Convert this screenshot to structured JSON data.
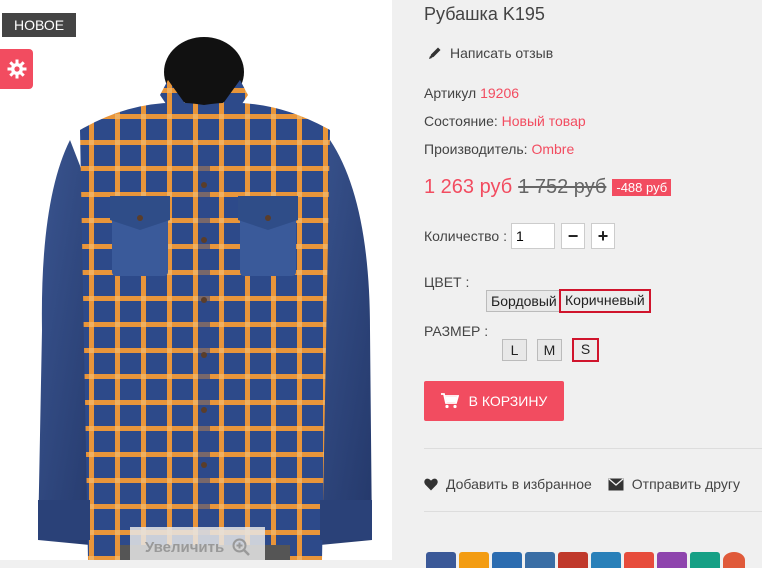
{
  "image_panel": {
    "new_badge": "НОВОЕ",
    "zoom_label": "Увеличить"
  },
  "product": {
    "title": "Рубашка K195",
    "write_review": "Написать отзыв",
    "sku_label": "Артикул",
    "sku_value": "19206",
    "condition_label": "Состояние:",
    "condition_value": "Новый товар",
    "manufacturer_label": "Производитель:",
    "manufacturer_value": "Ombre",
    "price_new": "1 263 руб",
    "price_old": "1 752 руб",
    "discount": "-488 руб",
    "quantity_label": "Количество :",
    "quantity_value": "1",
    "minus": "−",
    "plus": "+",
    "color_label": "ЦВЕТ :",
    "colors": [
      "Бордовый",
      "Коричневый"
    ],
    "selected_color": "Коричневый",
    "size_label": "РАЗМЕР :",
    "sizes": [
      "L",
      "M",
      "S"
    ],
    "selected_size": "S",
    "cart_button": "В КОРЗИНУ",
    "add_wishlist": "Добавить в избранное",
    "send_friend": "Отправить другу"
  },
  "colors": {
    "accent": "#f24c60",
    "badge_bg": "#444444",
    "selected_border": "#d0142c",
    "social": [
      "#3b5998",
      "#f39c12",
      "#2b6cb0",
      "#3a6ea5",
      "#c0392b",
      "#2980b9",
      "#e74c3c",
      "#8e44ad",
      "#16a085",
      "#e05a3a"
    ]
  }
}
